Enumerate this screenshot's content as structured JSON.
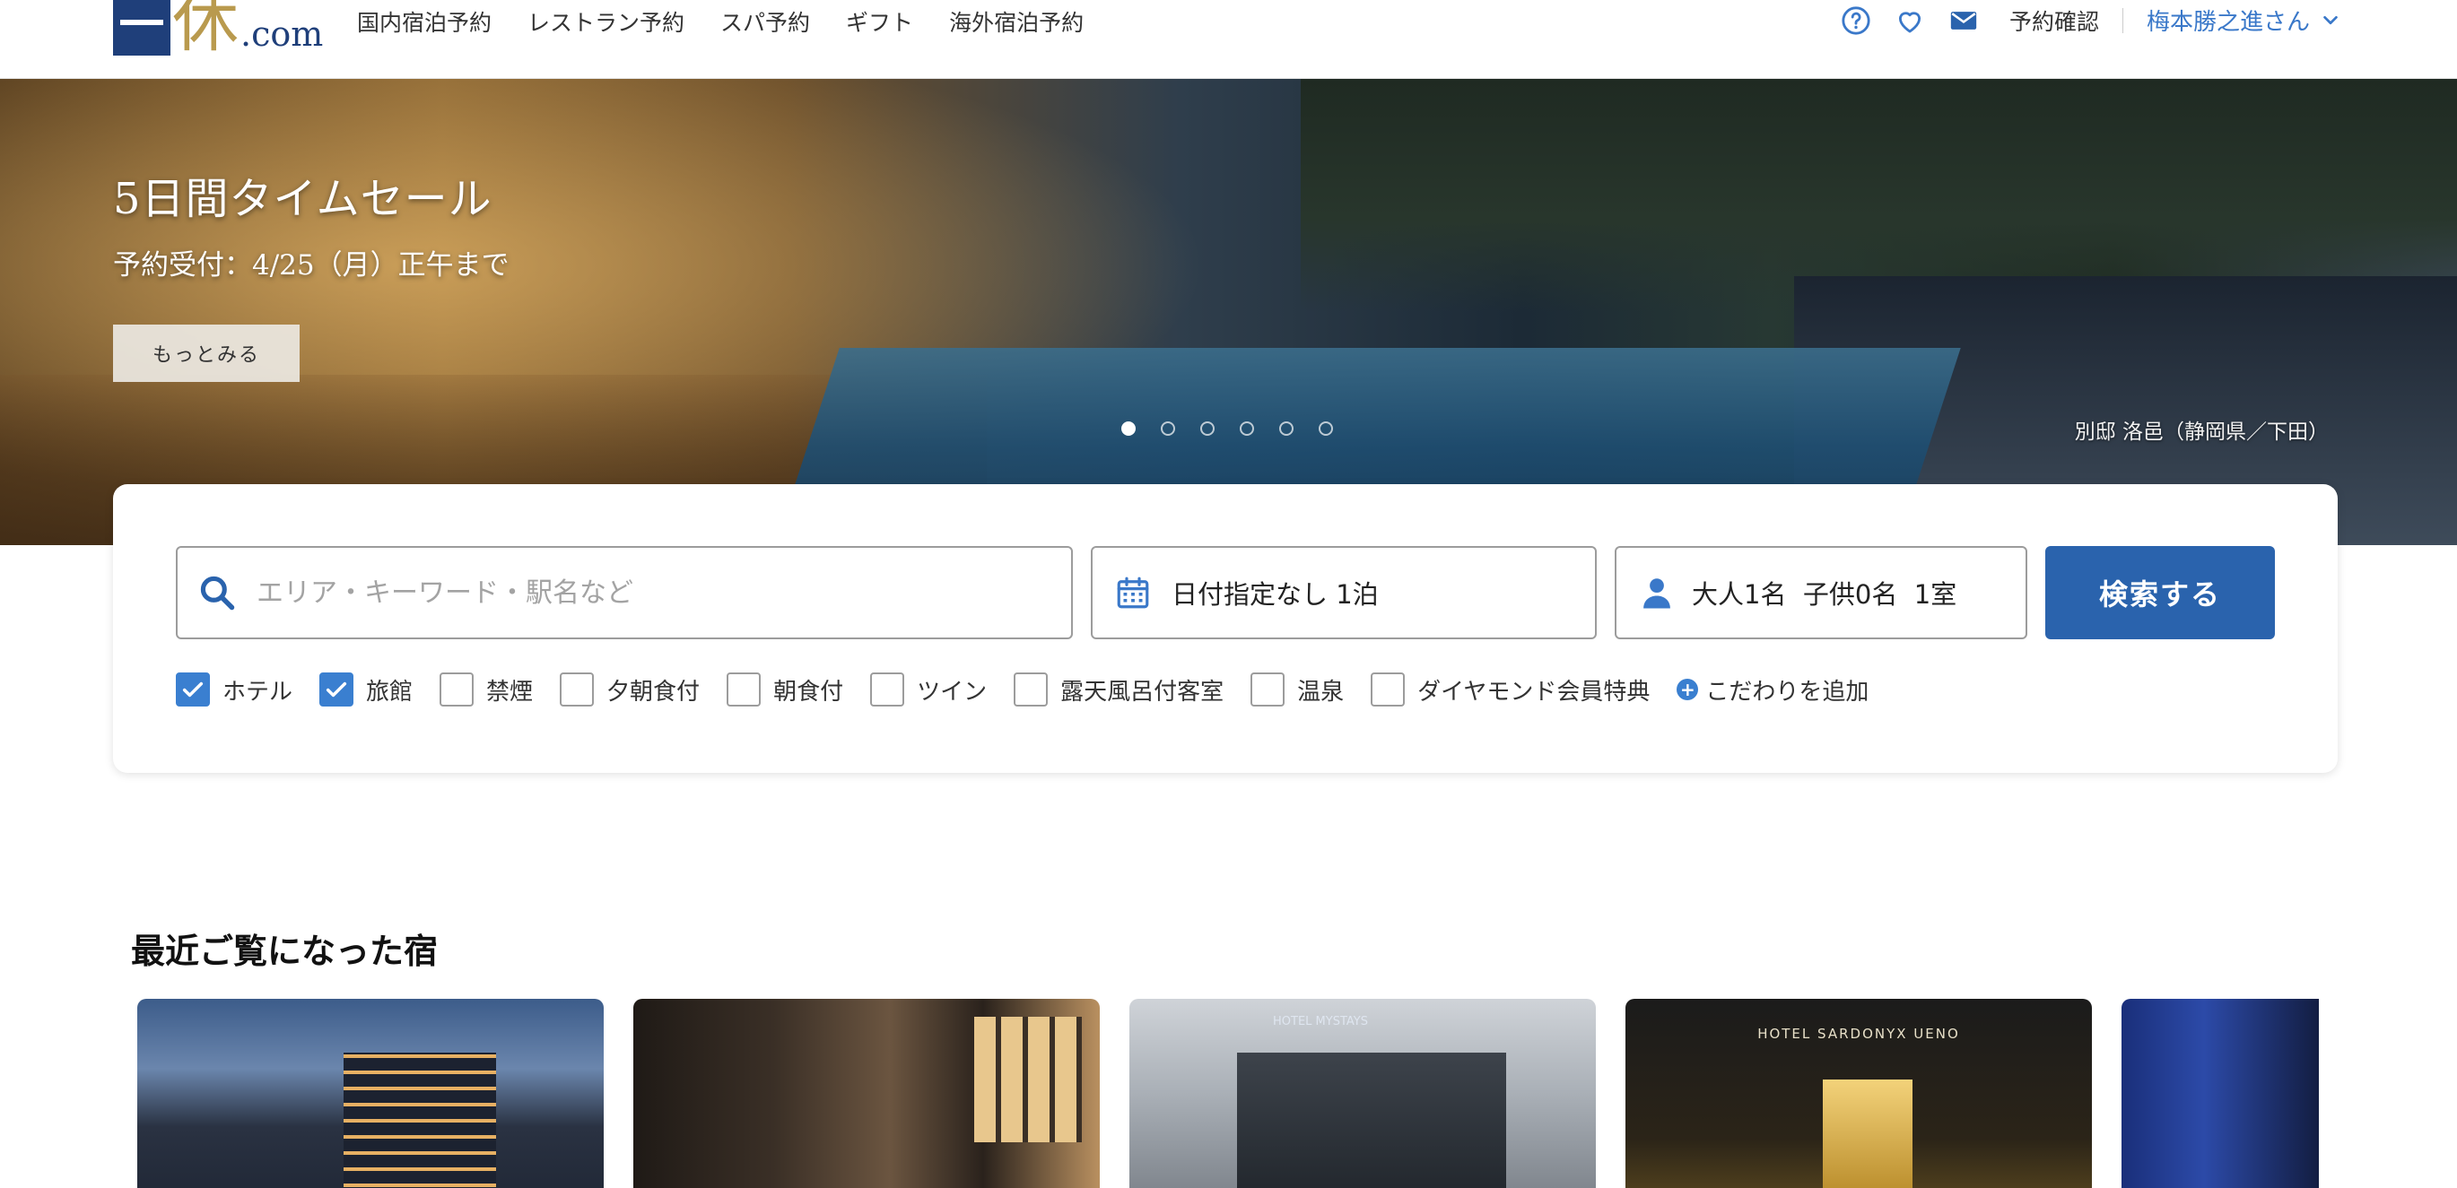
{
  "header": {
    "logo_text": "休",
    "logo_suffix": ".com",
    "nav": [
      "国内宿泊予約",
      "レストラン予約",
      "スパ予約",
      "ギフト",
      "海外宿泊予約"
    ],
    "reserve_link": "予約確認",
    "user_name": "梅本勝之進さん"
  },
  "hero": {
    "title": "5日間タイムセール",
    "subtitle": "予約受付：4/25（月）正午まで",
    "button": "もっとみる",
    "caption": "別邸 洛邑（静岡県／下田）",
    "slide_count": 6,
    "active_slide": 1
  },
  "search": {
    "keyword_placeholder": "エリア・キーワード・駅名など",
    "date_text": "日付指定なし 1泊",
    "guest_text": "大人1名  子供0名  1室",
    "button": "検索する",
    "filters": [
      {
        "label": "ホテル",
        "checked": true
      },
      {
        "label": "旅館",
        "checked": true
      },
      {
        "label": "禁煙",
        "checked": false
      },
      {
        "label": "夕朝食付",
        "checked": false
      },
      {
        "label": "朝食付",
        "checked": false
      },
      {
        "label": "ツイン",
        "checked": false
      },
      {
        "label": "露天風呂付客室",
        "checked": false
      },
      {
        "label": "温泉",
        "checked": false
      },
      {
        "label": "ダイヤモンド会員特典",
        "checked": false
      }
    ],
    "add_preference": "こだわりを追加"
  },
  "recent": {
    "title": "最近ご覧になった宿",
    "card_signs": [
      "HOTEL MYSTAYS",
      "HOTEL SARDONYX UENO"
    ]
  },
  "colors": {
    "accent": "#3a78c9",
    "search_button": "#2a63ad",
    "checkbox": "#3a7fd0"
  }
}
